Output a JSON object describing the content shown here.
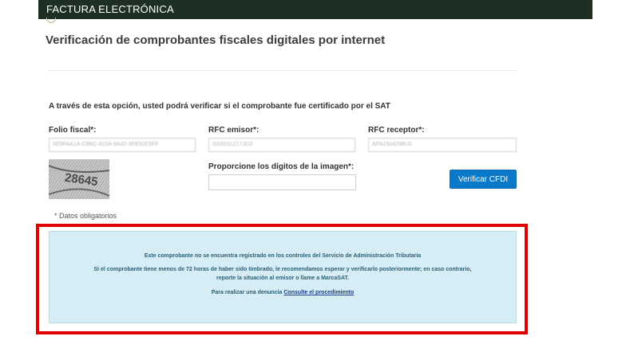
{
  "header": {
    "title": "FACTURA ELECTRÓNICA"
  },
  "page": {
    "title": "Verificación de comprobantes fiscales digitales por internet",
    "intro": "A través de esta opción, usted podrá verificar si el comprobante fue certificado por el SAT"
  },
  "form": {
    "folio_label": "Folio fiscal*:",
    "folio_value": "5E9FAA1A-CB6C-415A-9A42-9FE92E5FF",
    "rfc_emisor_label": "RFC emisor*:",
    "rfc_emisor_value": "SSS031217JG3",
    "rfc_receptor_label": "RFC receptor*:",
    "rfc_receptor_value": "APA1504298U0",
    "captcha_label": "Proporcione los dígitos de la imagen*:",
    "captcha_text": "28645",
    "captcha_input_value": "",
    "verify_button": "Verificar CFDI",
    "required_note": "* Datos obligatorios"
  },
  "alert": {
    "line1": "Este comprobante no se encuentra registrado en los controles del Servicio de Administración Tributaria",
    "line2": "Si el comprobante tiene menos de 72 horas de haber sido timbrado, le recomendamos esperar y verificarlo posteriormente; en caso contrario,",
    "line3": "reporte la situación al emisor o llame a MarcaSAT.",
    "line4_prefix": "Para realizar una denuncia ",
    "line4_link": "Consulte el procedimiento"
  },
  "colors": {
    "header_bg": "#1e3024",
    "button_bg": "#0a79c9",
    "alert_bg": "#d6edf6",
    "highlight_outline": "#e00000"
  }
}
